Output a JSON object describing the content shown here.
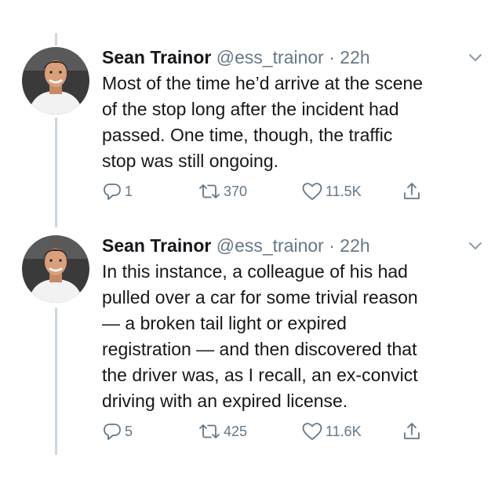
{
  "tweets": [
    {
      "author": "Sean Trainor",
      "handle": "@ess_trainor",
      "separator": "·",
      "time": "22h",
      "lines": [
        "Most of the time he’d arrive at the scene",
        "of the stop long after the incident had",
        "passed. One time, though, the traffic",
        "stop was still ongoing."
      ],
      "replies": "1",
      "retweets": "370",
      "likes": "11.5K"
    },
    {
      "author": "Sean Trainor",
      "handle": "@ess_trainor",
      "separator": "·",
      "time": "22h",
      "lines": [
        "In this instance, a colleague of his had",
        "pulled over a car for some trivial reason",
        "— a broken tail light or expired",
        "registration — and then discovered that",
        "the driver was, as I recall, an ex-convict",
        "driving with an expired license."
      ],
      "replies": "5",
      "retweets": "425",
      "likes": "11.6K"
    }
  ],
  "icons": {
    "reply": "reply-icon",
    "retweet": "retweet-icon",
    "like": "heart-icon",
    "share": "share-icon",
    "menu": "chevron-down-icon"
  },
  "colors": {
    "text": "#14171a",
    "secondary": "#657786",
    "thread_line": "#ccd6dd"
  }
}
